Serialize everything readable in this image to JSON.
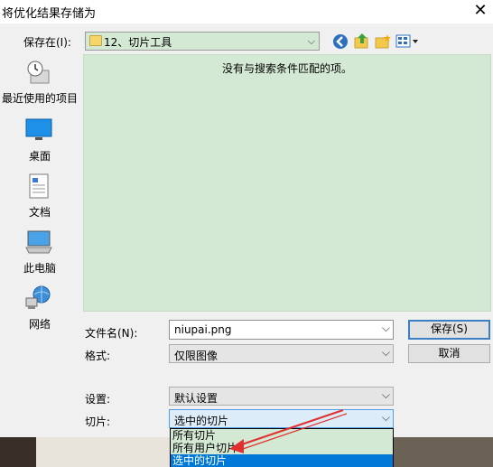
{
  "window": {
    "title": "将优化结果存储为",
    "close_glyph": "✕"
  },
  "save_in": {
    "label": "保存在(I):",
    "value": "12、切片工具",
    "folder_icon": "folder-icon"
  },
  "toolbar": {
    "back_icon": "back-icon",
    "up_icon": "up-folder-icon",
    "new_folder_icon": "new-folder-icon",
    "view_icon": "view-menu-icon"
  },
  "places": [
    {
      "label": "最近使用的项目",
      "icon": "recent-icon"
    },
    {
      "label": "桌面",
      "icon": "desktop-icon"
    },
    {
      "label": "文档",
      "icon": "documents-icon"
    },
    {
      "label": "此电脑",
      "icon": "computer-icon"
    },
    {
      "label": "网络",
      "icon": "network-icon"
    }
  ],
  "file_list": {
    "empty_message": "没有与搜索条件匹配的项。"
  },
  "filename": {
    "label": "文件名(N):",
    "value": "niupai.png"
  },
  "format": {
    "label": "格式:",
    "value": "仅限图像"
  },
  "settings": {
    "label": "设置:",
    "value": "默认设置"
  },
  "slices": {
    "label": "切片:",
    "value": "选中的切片",
    "options": [
      "所有切片",
      "所有用户切片",
      "选中的切片"
    ],
    "selected_index": 2
  },
  "buttons": {
    "save": "保存(S)",
    "cancel": "取消"
  },
  "colors": {
    "list_background": "#d4e9d4",
    "selection": "#0078d7",
    "annotation_arrow": "#e03030"
  }
}
